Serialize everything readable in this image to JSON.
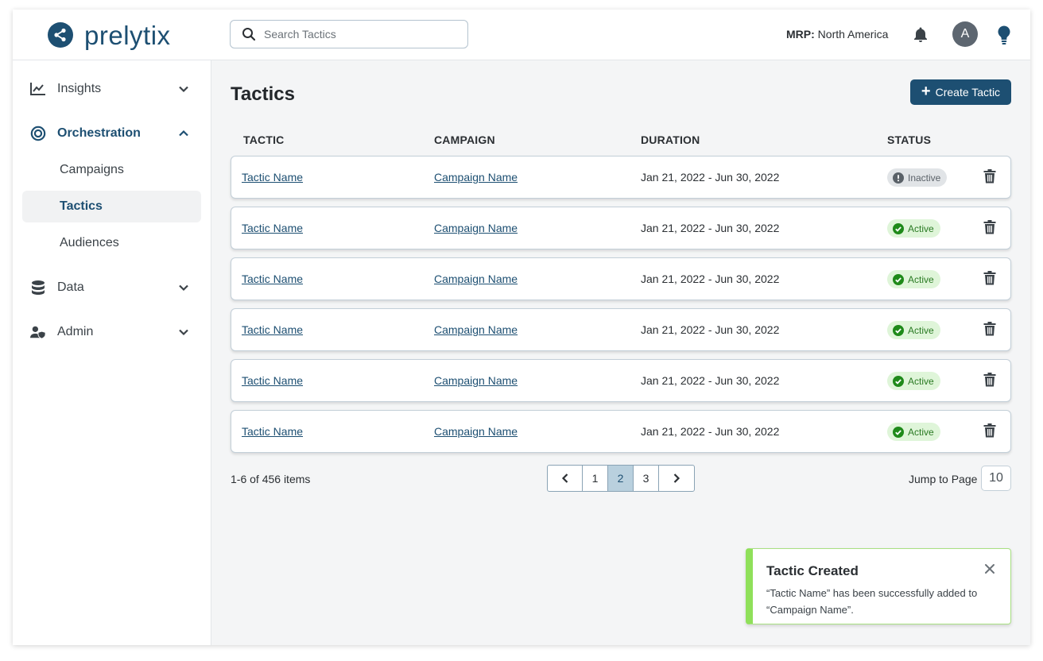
{
  "brand": {
    "name": "prelytix"
  },
  "search": {
    "placeholder": "Search Tactics"
  },
  "header": {
    "region_label": "MRP:",
    "region_value": "North America",
    "avatar_initial": "A"
  },
  "sidebar": {
    "items": [
      {
        "label": "Insights",
        "icon": "chart-line-icon",
        "expanded": false
      },
      {
        "label": "Orchestration",
        "icon": "target-icon",
        "expanded": true
      },
      {
        "label": "Data",
        "icon": "database-icon",
        "expanded": false
      },
      {
        "label": "Admin",
        "icon": "user-shield-icon",
        "expanded": false
      }
    ],
    "sub_items": [
      {
        "label": "Campaigns",
        "active": false
      },
      {
        "label": "Tactics",
        "active": true
      },
      {
        "label": "Audiences",
        "active": false
      }
    ]
  },
  "main": {
    "title": "Tactics",
    "create_button": "Create Tactic",
    "columns": [
      "TACTIC",
      "CAMPAIGN",
      "DURATION",
      "STATUS"
    ],
    "rows": [
      {
        "tactic": "Tactic Name",
        "campaign": "Campaign Name",
        "duration": "Jan 21, 2022 - Jun 30, 2022",
        "status": "Inactive"
      },
      {
        "tactic": "Tactic Name",
        "campaign": "Campaign Name",
        "duration": "Jan 21, 2022 - Jun 30, 2022",
        "status": "Active"
      },
      {
        "tactic": "Tactic Name",
        "campaign": "Campaign Name",
        "duration": "Jan 21, 2022 - Jun 30, 2022",
        "status": "Active"
      },
      {
        "tactic": "Tactic Name",
        "campaign": "Campaign Name",
        "duration": "Jan 21, 2022 - Jun 30, 2022",
        "status": "Active"
      },
      {
        "tactic": "Tactic Name",
        "campaign": "Campaign Name",
        "duration": "Jan 21, 2022 - Jun 30, 2022",
        "status": "Active"
      },
      {
        "tactic": "Tactic Name",
        "campaign": "Campaign Name",
        "duration": "Jan 21, 2022 - Jun 30, 2022",
        "status": "Active"
      }
    ],
    "items_count": "1-6 of 456 items",
    "pagination": {
      "pages": [
        "1",
        "2",
        "3"
      ],
      "current": "2"
    },
    "jump_label": "Jump to Page",
    "jump_value": "10"
  },
  "toast": {
    "title": "Tactic Created",
    "message": "“Tactic Name” has been successfully added to “Campaign Name”."
  },
  "colors": {
    "brand": "#1d4f72",
    "active_bg": "#dff5d9",
    "active_fg": "#2a7a23",
    "inactive_bg": "#e1e4e7",
    "toast_accent": "#8fe05a",
    "current_page": "#b9d0de"
  }
}
